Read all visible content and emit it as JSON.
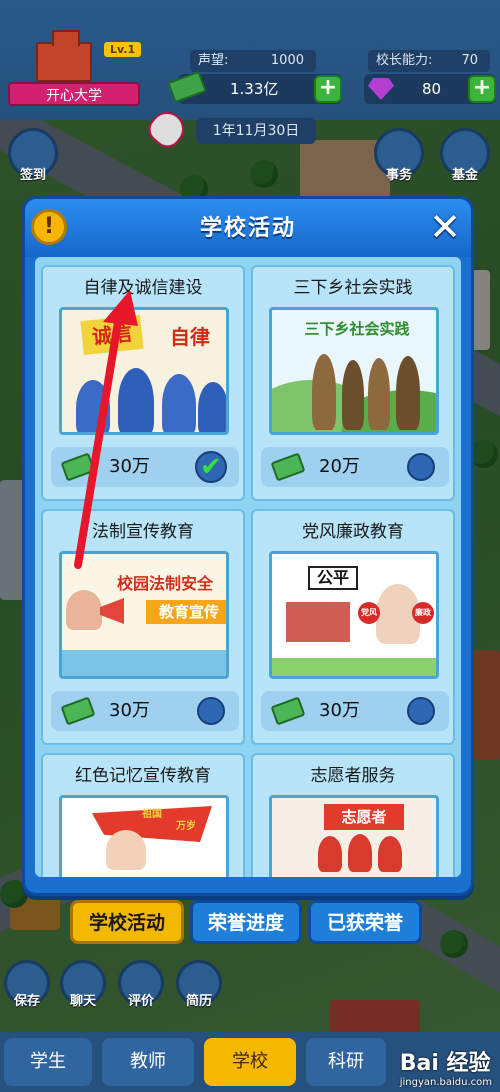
{
  "hud": {
    "school_level": "Lv.1",
    "school_name": "开心大学",
    "reputation_label": "声望:",
    "reputation_value": "1000",
    "principal_label": "校长能力:",
    "principal_value": "70",
    "cash_value": "1.33亿",
    "gem_value": "80",
    "date": "1年11月30日",
    "left_button_label": "签到",
    "right_buttons": [
      "事务",
      "基金"
    ]
  },
  "modal": {
    "title": "学校活动",
    "warn_glyph": "!",
    "close_glyph": "✕",
    "activities": [
      {
        "title": "自律及诚信建设",
        "image_text": [
          "诚信",
          "自律"
        ],
        "cost": "30万",
        "completed": true
      },
      {
        "title": "三下乡社会实践",
        "image_text": [
          "三下乡社会实践"
        ],
        "cost": "20万",
        "completed": false
      },
      {
        "title": "法制宣传教育",
        "image_text": [
          "校园法制安全",
          "教育宣传"
        ],
        "cost": "30万",
        "completed": false
      },
      {
        "title": "党风廉政教育",
        "image_text": [
          "公平",
          "党风",
          "廉政"
        ],
        "cost": "30万",
        "completed": false
      },
      {
        "title": "红色记忆宣传教育",
        "image_text": [
          "祖国",
          "万岁"
        ],
        "cost": "",
        "completed": false
      },
      {
        "title": "志愿者服务",
        "image_text": [
          "志愿者"
        ],
        "cost": "",
        "completed": false
      }
    ],
    "check_glyph": "✔"
  },
  "tabs": [
    "学校活动",
    "荣誉进度",
    "已获荣誉"
  ],
  "tools": [
    "保存",
    "聊天",
    "评价",
    "简历"
  ],
  "nav": [
    "学生",
    "教师",
    "学校",
    "科研"
  ],
  "watermark": {
    "brand": "Bai 经验",
    "url": "jingyan.baidu.com"
  },
  "colors": {
    "modal_blue": "#1a6fcf",
    "tab_active": "#f5b800",
    "annotation_arrow": "#e8162a",
    "confirm_green": "#3db53a"
  }
}
